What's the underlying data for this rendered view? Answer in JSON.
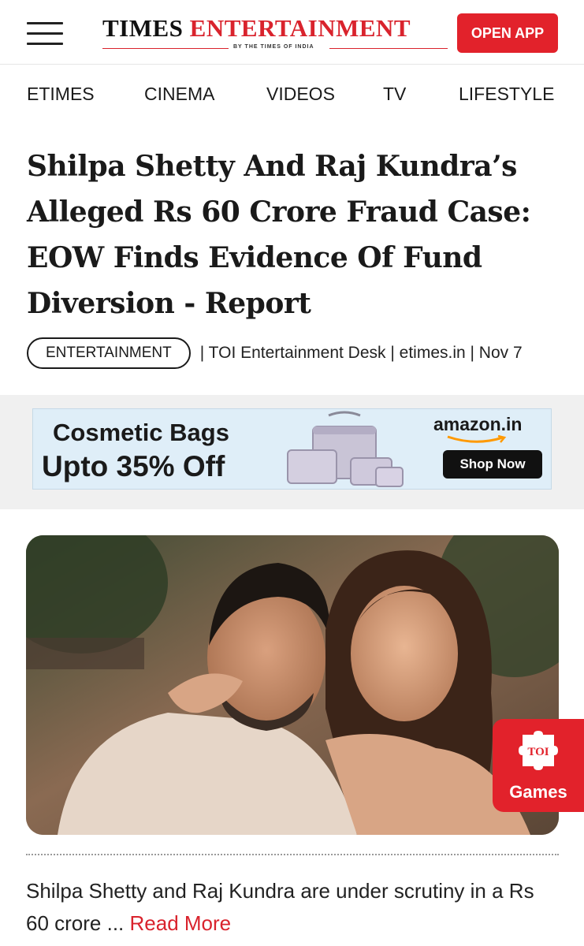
{
  "header": {
    "logo_times": "TIMES",
    "logo_entertainment": "ENTERTAINMENT",
    "logo_tagline": "BY THE TIMES OF INDIA",
    "open_app_label": "OPEN APP"
  },
  "nav": {
    "items": [
      "ETIMES",
      "CINEMA",
      "VIDEOS",
      "TV",
      "LIFESTYLE"
    ]
  },
  "article": {
    "headline": "Shilpa Shetty And Raj Kundra’s Alleged Rs 60 Crore Fraud Case: EOW Finds Evidence Of Fund Diversion - Report",
    "category": "ENTERTAINMENT",
    "byline": "| TOI Entertainment Desk | etimes.in | Nov 7",
    "summary": "Shilpa Shetty and Raj Kundra are under scrutiny in a Rs 60 crore ...",
    "read_more": "Read More"
  },
  "ad": {
    "title": "Cosmetic Bags",
    "offer": "Upto 35% Off",
    "brand": "amazon.in",
    "cta": "Shop Now"
  },
  "games_badge": {
    "icon_text": "TOI",
    "label": "Games"
  },
  "colors": {
    "brand_red": "#e2222b",
    "text_dark": "#1a1a1a",
    "ad_background": "#dfeef8"
  }
}
